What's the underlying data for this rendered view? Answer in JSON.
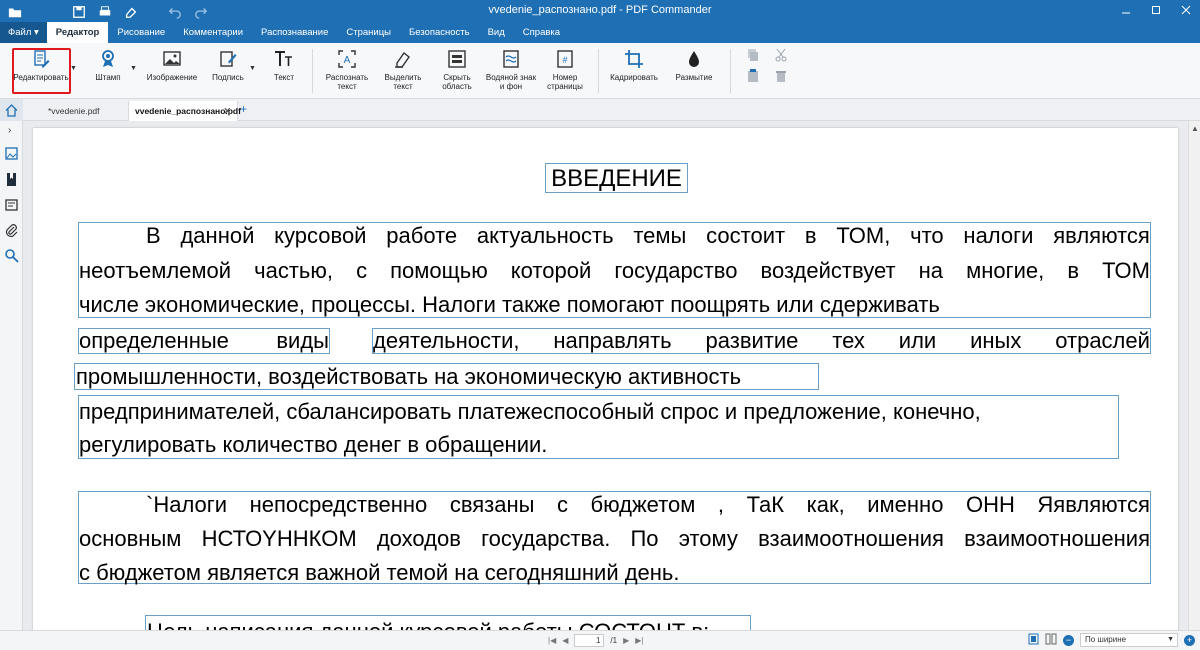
{
  "window": {
    "title": "vvedenie_распознано.pdf - PDF Commander"
  },
  "menu": {
    "tabs": [
      {
        "label": "Файл ▾"
      },
      {
        "label": "Редактор"
      },
      {
        "label": "Рисование"
      },
      {
        "label": "Комментарии"
      },
      {
        "label": "Распознавание"
      },
      {
        "label": "Страницы"
      },
      {
        "label": "Безопасность"
      },
      {
        "label": "Вид"
      },
      {
        "label": "Справка"
      }
    ],
    "active_tab": "Редактор"
  },
  "ribbon": {
    "edit": "Редактировать",
    "stamp": "Штамп",
    "image": "Изображение",
    "signature": "Подпись",
    "text": "Текст",
    "recognize_1": "Распознать",
    "recognize_2": "текст",
    "select_1": "Выделить",
    "select_2": "текст",
    "hide_1": "Скрыть",
    "hide_2": "область",
    "watermark_1": "Водяной знак",
    "watermark_2": "и фон",
    "pagenum_1": "Номер",
    "pagenum_2": "страницы",
    "crop": "Кадрировать",
    "blur": "Размытие"
  },
  "doc_tabs": {
    "tab1": "*vvedenie.pdf",
    "tab2": "vvedenie_распознано.pdf"
  },
  "document": {
    "heading": "ВВЕДЕНИЕ",
    "p1": {
      "l1": [
        "В",
        "данной",
        "курсовой",
        "работе",
        "актуальность",
        "темы",
        "состоит",
        "в",
        "ТОМ,",
        "что",
        "налоги",
        "являются"
      ],
      "l2": [
        "неотъемлемой",
        "частью,",
        "с",
        "помощью",
        "которой",
        "государство",
        "воздействует",
        "на",
        "многие,",
        "в",
        "ТОМ"
      ],
      "l3": "числе экономические, процессы. Налоги также помогают поощрять или  сдерживать"
    },
    "p2a": [
      "определенные",
      "виды"
    ],
    "p2b": [
      "деятельности,",
      "направлять",
      "развитие",
      "тех",
      "или",
      "иных",
      "отраслей"
    ],
    "p2c": "промышленности, воздействовать на экономическую активность",
    "p3": {
      "l1": "предпринимателей, сбалансировать платежеспособный спрос и предложение, конечно,",
      "l2": "регулировать количество денег в  обращении."
    },
    "p4": {
      "l1": [
        "`Налоги",
        "непосредственно",
        "связаны",
        "с",
        "бюджетом",
        ",",
        "ТаК",
        "как,",
        "именно",
        "ОНН",
        "Яявляются"
      ],
      "l2": [
        "основным",
        "НСТОYННКОМ",
        "доходов",
        "государства.",
        "По",
        "этому",
        "взаимоотношения",
        "взаимоотношения"
      ],
      "l3": "с бюджетом является важной темой на сегодняшний день."
    },
    "p5": "Цель написания данной    курсовой работы СОСТОНТ в:"
  },
  "status": {
    "page_current": "1",
    "page_total": "/1",
    "zoom": "По ширине"
  }
}
